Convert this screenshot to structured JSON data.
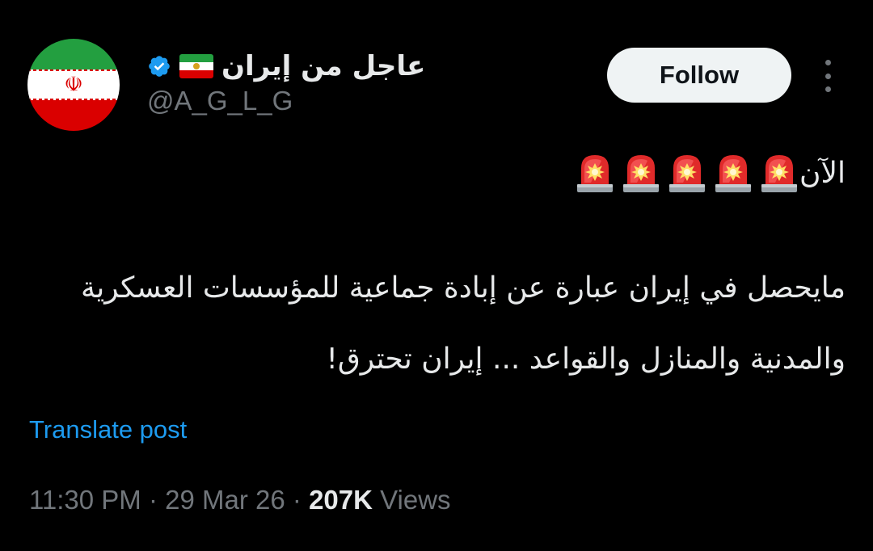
{
  "author": {
    "display_name": "عاجل من إيران",
    "handle": "@A_G_L_G",
    "verified": true,
    "avatar": "iran-flag-avatar",
    "name_flag": "iran-lion-sun-flag"
  },
  "follow_button": {
    "label": "Follow"
  },
  "more_menu": {
    "icon": "more-vertical-icon"
  },
  "tweet": {
    "line1_text": "الآن",
    "siren_icon": "rotating-light-icon",
    "siren_count": 5,
    "line2_text": "مايحصل في إيران عبارة عن إبادة جماعية للمؤسسات العسكرية",
    "line3_text": "والمدنية والمنازل والقواعد ... إيران تحترق!"
  },
  "translate_link": {
    "label": "Translate post"
  },
  "meta": {
    "time": "11:30 PM",
    "sep1": " · ",
    "date": "29 Mar 26",
    "sep2": " · ",
    "views_count": "207K",
    "views_label": " Views"
  },
  "colors": {
    "background": "#000000",
    "text": "#e7e9ea",
    "muted": "#71767b",
    "link": "#1d9bf0",
    "verified": "#1d9bf0"
  }
}
